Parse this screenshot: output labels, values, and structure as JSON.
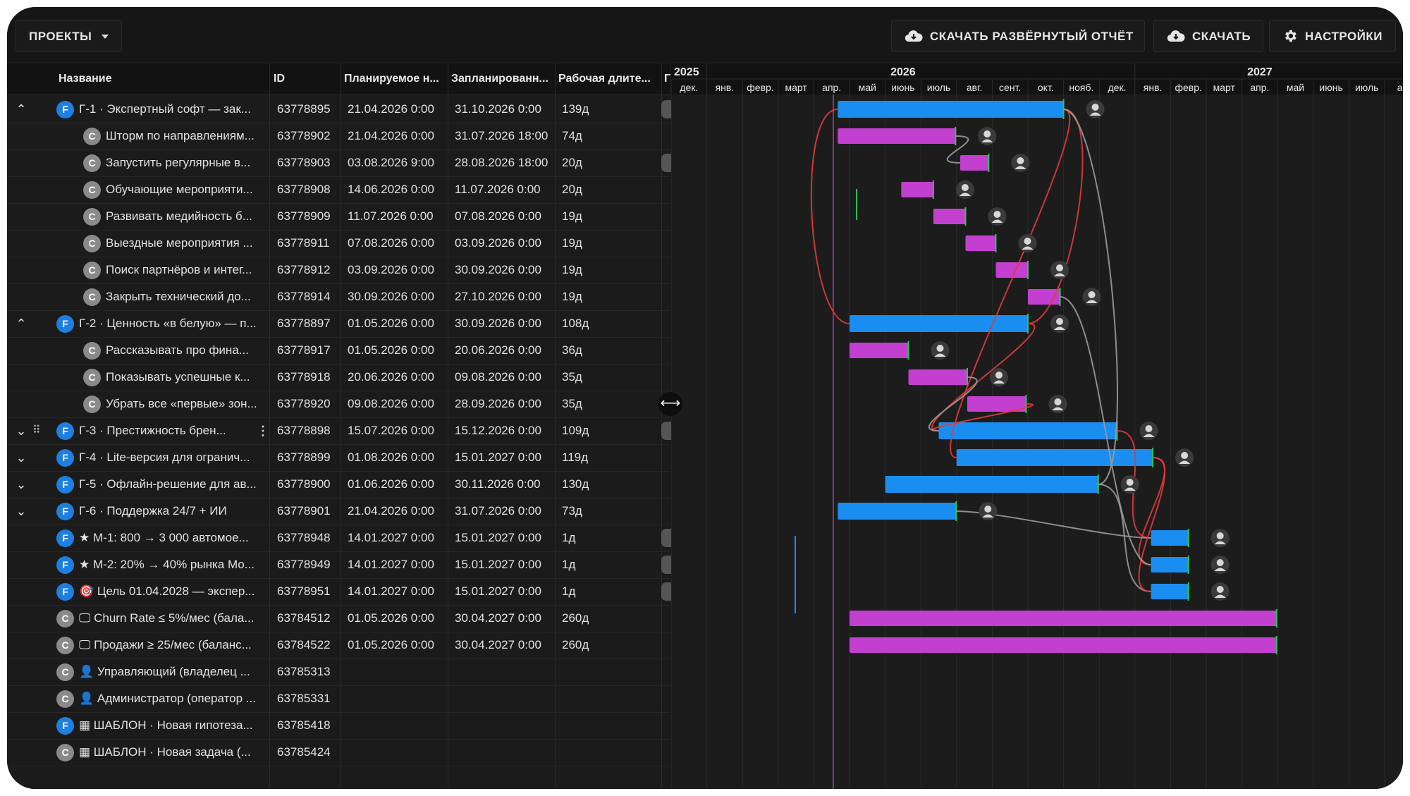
{
  "toolbar": {
    "projects_label": "ПРОЕКТЫ",
    "download_full_label": "СКАЧАТЬ РАЗВЁРНУТЫЙ ОТЧЁТ",
    "download_label": "СКАЧАТЬ",
    "settings_label": "НАСТРОЙКИ"
  },
  "grid": {
    "columns": [
      "Название",
      "ID",
      "Планируемое н...",
      "Запланированн...",
      "Рабочая длите...",
      "Г"
    ],
    "rows": [
      {
        "chevron": "up",
        "badge": "F",
        "name": "Г-1 · Экспертный софт — зак...",
        "id": "63778895",
        "start": "21.04.2026 0:00",
        "end": "31.10.2026 0:00",
        "dur": "139д"
      },
      {
        "chevron": "",
        "badge": "C",
        "name": "Шторм по направлениям...",
        "id": "63778902",
        "start": "21.04.2026 0:00",
        "end": "31.07.2026 18:00",
        "dur": "74д"
      },
      {
        "chevron": "",
        "badge": "C",
        "name": "Запустить регулярные в...",
        "id": "63778903",
        "start": "03.08.2026 9:00",
        "end": "28.08.2026 18:00",
        "dur": "20д"
      },
      {
        "chevron": "",
        "badge": "C",
        "name": "Обучающие мероприяти...",
        "id": "63778908",
        "start": "14.06.2026 0:00",
        "end": "11.07.2026 0:00",
        "dur": "20д"
      },
      {
        "chevron": "",
        "badge": "C",
        "name": "Развивать медийность б...",
        "id": "63778909",
        "start": "11.07.2026 0:00",
        "end": "07.08.2026 0:00",
        "dur": "19д"
      },
      {
        "chevron": "",
        "badge": "C",
        "name": "Выездные мероприятия ...",
        "id": "63778911",
        "start": "07.08.2026 0:00",
        "end": "03.09.2026 0:00",
        "dur": "19д"
      },
      {
        "chevron": "",
        "badge": "C",
        "name": "Поиск партнёров и интег...",
        "id": "63778912",
        "start": "03.09.2026 0:00",
        "end": "30.09.2026 0:00",
        "dur": "19д"
      },
      {
        "chevron": "",
        "badge": "C",
        "name": "Закрыть технический до...",
        "id": "63778914",
        "start": "30.09.2026 0:00",
        "end": "27.10.2026 0:00",
        "dur": "19д"
      },
      {
        "chevron": "up",
        "badge": "F",
        "name": "Г-2 · Ценность «в белую» — п...",
        "id": "63778897",
        "start": "01.05.2026 0:00",
        "end": "30.09.2026 0:00",
        "dur": "108д"
      },
      {
        "chevron": "",
        "badge": "C",
        "name": "Рассказывать про фина...",
        "id": "63778917",
        "start": "01.05.2026 0:00",
        "end": "20.06.2026 0:00",
        "dur": "36д"
      },
      {
        "chevron": "",
        "badge": "C",
        "name": "Показывать успешные к...",
        "id": "63778918",
        "start": "20.06.2026 0:00",
        "end": "09.08.2026 0:00",
        "dur": "35д"
      },
      {
        "chevron": "",
        "badge": "C",
        "name": "Убрать все «первые» зон...",
        "id": "63778920",
        "start": "09.08.2026 0:00",
        "end": "28.09.2026 0:00",
        "dur": "35д"
      },
      {
        "chevron": "down",
        "badge": "F",
        "name": "Г-3 · Престижность брен...",
        "id": "63778898",
        "start": "15.07.2026 0:00",
        "end": "15.12.2026 0:00",
        "dur": "109д"
      },
      {
        "chevron": "down",
        "badge": "F",
        "name": "Г-4 · Lite-версия для огранич...",
        "id": "63778899",
        "start": "01.08.2026 0:00",
        "end": "15.01.2027 0:00",
        "dur": "119д"
      },
      {
        "chevron": "down",
        "badge": "F",
        "name": "Г-5 · Офлайн-решение для ав...",
        "id": "63778900",
        "start": "01.06.2026 0:00",
        "end": "30.11.2026 0:00",
        "dur": "130д"
      },
      {
        "chevron": "down",
        "badge": "F",
        "name": "Г-6 · Поддержка 24/7 + ИИ",
        "id": "63778901",
        "start": "21.04.2026 0:00",
        "end": "31.07.2026 0:00",
        "dur": "73д"
      },
      {
        "chevron": "",
        "badge": "F",
        "name": "★ М-1: 800 → 3 000 автомое...",
        "id": "63778948",
        "start": "14.01.2027 0:00",
        "end": "15.01.2027 0:00",
        "dur": "1д"
      },
      {
        "chevron": "",
        "badge": "F",
        "name": "★ М-2: 20% → 40% рынка Мо...",
        "id": "63778949",
        "start": "14.01.2027 0:00",
        "end": "15.01.2027 0:00",
        "dur": "1д"
      },
      {
        "chevron": "",
        "badge": "F",
        "name": "🎯 Цель 01.04.2028 — экспер...",
        "id": "63778951",
        "start": "14.01.2027 0:00",
        "end": "15.01.2027 0:00",
        "dur": "1д"
      },
      {
        "chevron": "",
        "badge": "C",
        "name": "🖵 Churn Rate ≤ 5%/мес (бала...",
        "id": "63784512",
        "start": "01.05.2026 0:00",
        "end": "30.04.2027 0:00",
        "dur": "260д"
      },
      {
        "chevron": "",
        "badge": "C",
        "name": "🖵 Продажи ≥ 25/мес (баланс...",
        "id": "63784522",
        "start": "01.05.2026 0:00",
        "end": "30.04.2027 0:00",
        "dur": "260д"
      },
      {
        "chevron": "",
        "badge": "C",
        "name": "👤 Управляющий (владелец ...",
        "id": "63785313",
        "start": "",
        "end": "",
        "dur": ""
      },
      {
        "chevron": "",
        "badge": "C",
        "name": "👤 Администратор (оператор ...",
        "id": "63785331",
        "start": "",
        "end": "",
        "dur": ""
      },
      {
        "chevron": "",
        "badge": "F",
        "name": "▦ ШАБЛОН · Новая гипотеза...",
        "id": "63785418",
        "start": "",
        "end": "",
        "dur": ""
      },
      {
        "chevron": "",
        "badge": "C",
        "name": "▦ ШАБЛОН · Новая задача (...",
        "id": "63785424",
        "start": "",
        "end": "",
        "dur": ""
      }
    ]
  },
  "timeline": {
    "years": [
      "2025",
      "2026",
      "2027"
    ],
    "months": [
      "дек.",
      "янв.",
      "февр.",
      "март",
      "апр.",
      "май",
      "июнь",
      "июль",
      "авг.",
      "сент.",
      "окт.",
      "нояб.",
      "дек.",
      "янв.",
      "февр.",
      "март",
      "апр.",
      "май",
      "июнь",
      "июль",
      "ав"
    ],
    "bars": [
      {
        "row": 0,
        "kind": "parent",
        "start": 4.67,
        "end": 11.0
      },
      {
        "row": 1,
        "kind": "task",
        "start": 4.67,
        "end": 7.97
      },
      {
        "row": 2,
        "kind": "task",
        "start": 8.1,
        "end": 8.9
      },
      {
        "row": 3,
        "kind": "task",
        "start": 6.45,
        "end": 7.35
      },
      {
        "row": 4,
        "kind": "task",
        "start": 7.35,
        "end": 8.25
      },
      {
        "row": 5,
        "kind": "task",
        "start": 8.25,
        "end": 9.1
      },
      {
        "row": 6,
        "kind": "task",
        "start": 9.1,
        "end": 10.0
      },
      {
        "row": 7,
        "kind": "task",
        "start": 10.0,
        "end": 10.9
      },
      {
        "row": 8,
        "kind": "parent",
        "start": 5.0,
        "end": 10.0
      },
      {
        "row": 9,
        "kind": "task",
        "start": 5.0,
        "end": 6.65
      },
      {
        "row": 10,
        "kind": "task",
        "start": 6.65,
        "end": 8.3
      },
      {
        "row": 11,
        "kind": "task",
        "start": 8.3,
        "end": 9.95
      },
      {
        "row": 12,
        "kind": "parent",
        "start": 7.5,
        "end": 12.5
      },
      {
        "row": 13,
        "kind": "parent",
        "start": 8.0,
        "end": 13.5
      },
      {
        "row": 14,
        "kind": "parent",
        "start": 6.0,
        "end": 11.97
      },
      {
        "row": 15,
        "kind": "parent",
        "start": 4.67,
        "end": 7.99
      },
      {
        "row": 16,
        "kind": "milestone",
        "start": 13.45,
        "end": 14.5
      },
      {
        "row": 17,
        "kind": "milestone",
        "start": 13.45,
        "end": 14.5
      },
      {
        "row": 18,
        "kind": "milestone",
        "start": 13.45,
        "end": 14.5
      },
      {
        "row": 19,
        "kind": "task",
        "start": 5.0,
        "end": 16.97
      },
      {
        "row": 20,
        "kind": "task",
        "start": 5.0,
        "end": 16.97
      }
    ],
    "avatar_rows": [
      0,
      1,
      2,
      3,
      4,
      5,
      6,
      7,
      8,
      9,
      10,
      11,
      12,
      13,
      14,
      15,
      16,
      17,
      18
    ]
  }
}
